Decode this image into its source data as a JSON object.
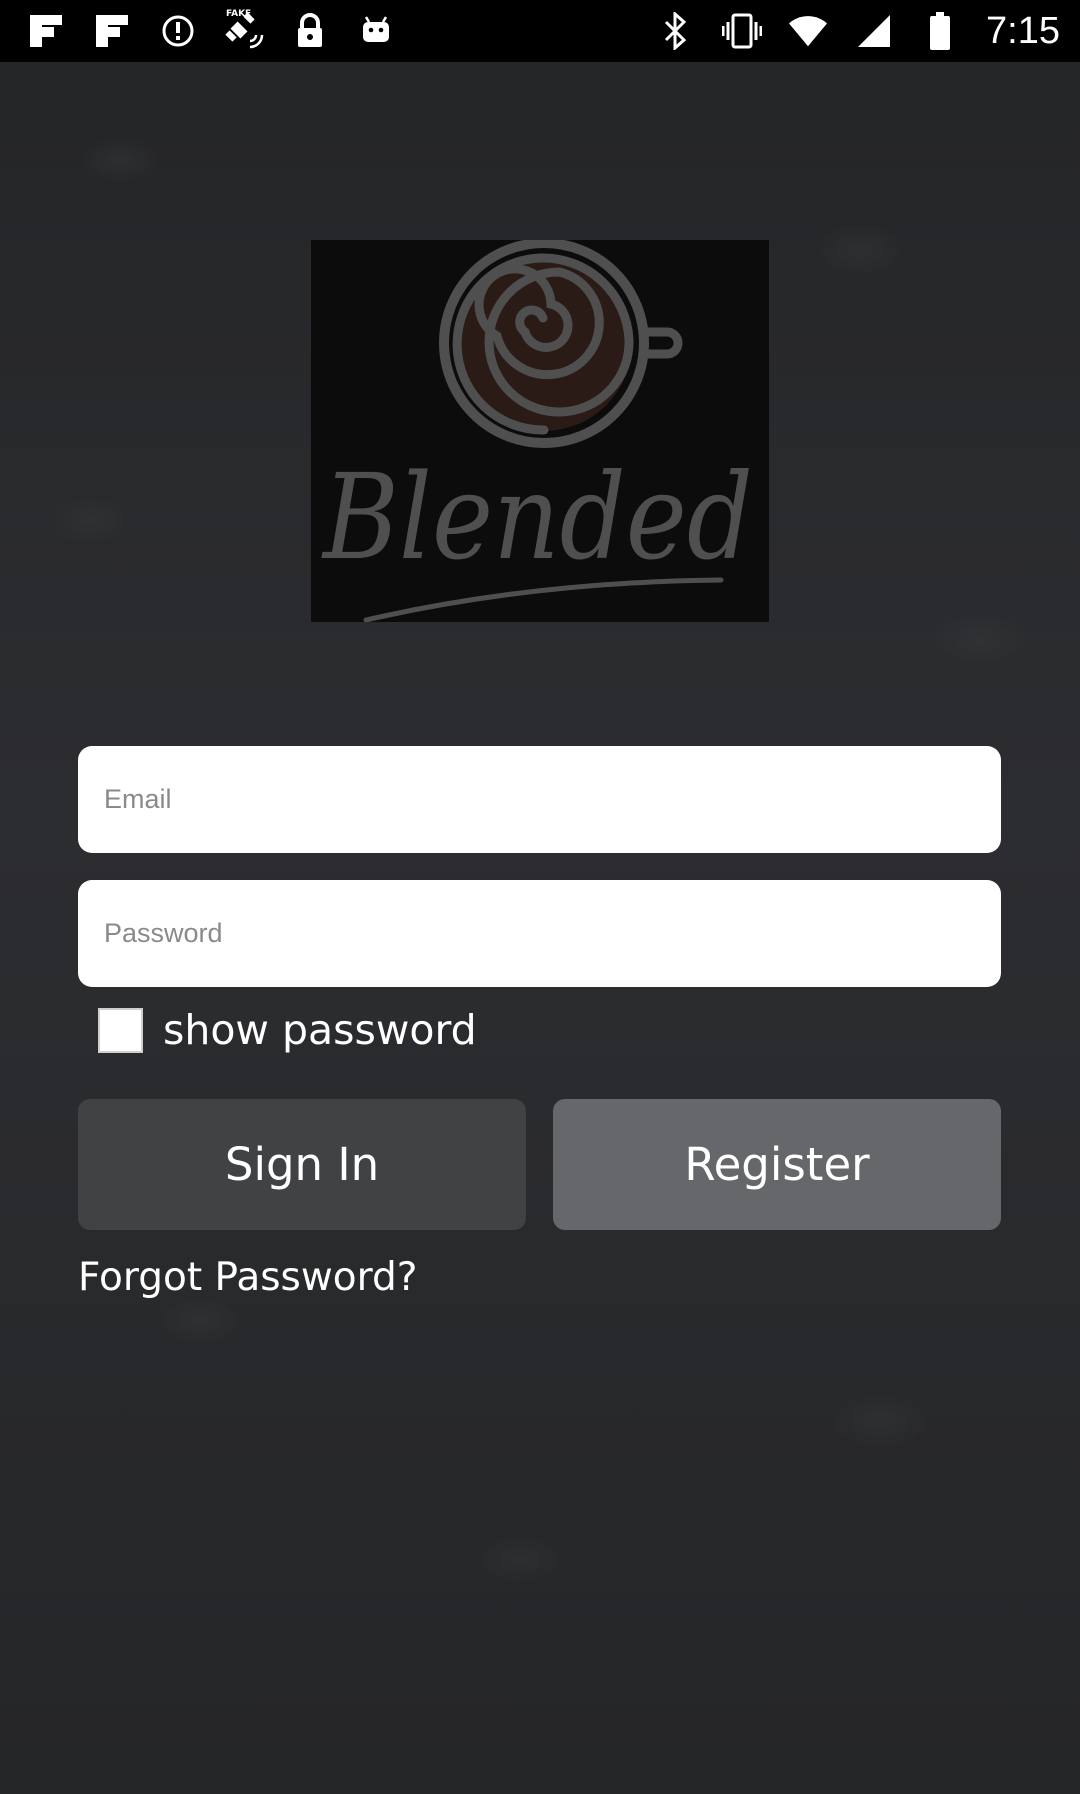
{
  "status_bar": {
    "time": "7:15",
    "left_icons": [
      "flipboard-icon",
      "flipboard-icon",
      "data-saver-icon",
      "fake-gps-satellite-icon",
      "lock-icon",
      "android-icon"
    ],
    "right_icons": [
      "bluetooth-icon",
      "vibrate-icon",
      "wifi-icon",
      "signal-icon",
      "battery-icon"
    ],
    "fake_label": "FAKE"
  },
  "logo": {
    "text": "Blended",
    "icon": "coffee-cup-swirl-icon"
  },
  "form": {
    "email_placeholder": "Email",
    "email_value": "",
    "password_placeholder": "Password",
    "password_value": "",
    "show_password_label": "show password",
    "show_password_checked": false
  },
  "buttons": {
    "sign_in": "Sign In",
    "register": "Register"
  },
  "links": {
    "forgot_password": "Forgot Password?"
  },
  "colors": {
    "background": "#2a2b2d",
    "sign_in_bg": "#414244",
    "register_bg": "#66676a",
    "logo_gray": "#4e4e4e",
    "logo_brown": "#3a2621"
  }
}
